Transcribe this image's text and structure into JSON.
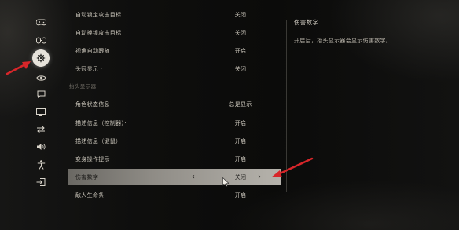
{
  "sidebar": {
    "items": [
      {
        "icon": "gamepad-icon"
      },
      {
        "icon": "controller-alt-icon"
      },
      {
        "icon": "gear-icon",
        "active": true
      },
      {
        "icon": "eye-icon"
      },
      {
        "icon": "chat-icon"
      },
      {
        "icon": "monitor-icon"
      },
      {
        "icon": "swap-arrows-icon"
      },
      {
        "icon": "speaker-icon"
      },
      {
        "icon": "accessibility-person-icon"
      },
      {
        "icon": "exit-icon"
      }
    ]
  },
  "settings": {
    "rows_top": [
      {
        "label": "自动锁定攻击目标",
        "value": "关闭"
      },
      {
        "label": "自动换锁攻击目标",
        "value": "关闭"
      },
      {
        "label": "视角自动跟随",
        "value": "开启"
      },
      {
        "label": "头冠显示 ·",
        "value": "关闭"
      }
    ],
    "section_header": "抬头显示器",
    "rows_bottom": [
      {
        "label": "角色状态信息 ·",
        "value": "总是显示"
      },
      {
        "label": "描述信息（控制器）·",
        "value": "开启"
      },
      {
        "label": "描述信息（键鼠）·",
        "value": "开启"
      },
      {
        "label": "变身操作提示",
        "value": "开启"
      },
      {
        "label": "伤害数字",
        "value": "关闭",
        "selected": true
      },
      {
        "label": "敌人生命条",
        "value": "开启"
      }
    ]
  },
  "description": {
    "title": "伤害数字",
    "body": "开启后，抬头显示器会显示伤害数字。"
  },
  "colors": {
    "annotation_arrow": "#d8262a",
    "selected_row": "#b6b3ac",
    "active_icon_bg": "#e7e3db"
  }
}
